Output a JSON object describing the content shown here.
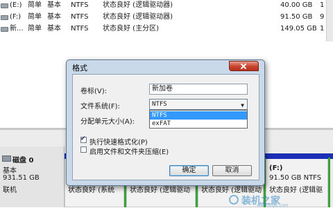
{
  "volumes": [
    {
      "volume": "(E:)",
      "layout": "简单",
      "type": "基本",
      "fs": "NTFS",
      "status": "状态良好 (逻辑驱动器)",
      "capacity": "40.00 GB",
      "free": "1"
    },
    {
      "volume": "(F:)",
      "layout": "简单",
      "type": "基本",
      "fs": "NTFS",
      "status": "状态良好 (逻辑驱动器)",
      "capacity": "91.50 GB",
      "free": "9"
    },
    {
      "volume": "新...",
      "layout": "简单",
      "type": "基本",
      "fs": "NTFS",
      "status": "状态良好 (主分区)",
      "capacity": "149.05 GB",
      "free": "1"
    }
  ],
  "disk": {
    "name": "磁盘 0",
    "type": "基本",
    "size": "931.51 GB",
    "state": "联机"
  },
  "partitions": [
    {
      "l1": "",
      "l2": "",
      "l3": "状态良好 (系统"
    },
    {
      "l1": "",
      "l2": "",
      "l3": "状态良好 (逻辑驱动"
    },
    {
      "l1": "",
      "l2": "",
      "l3": "状态良好 (逻辑驱动"
    },
    {
      "l1": "(F:)",
      "l2": "91.50 GB NTFS",
      "l3": "状态良好 (逻辑驱"
    }
  ],
  "dialog": {
    "title": "格式",
    "label_volume": "卷标(V):",
    "volume_value": "新加卷",
    "label_fs": "文件系统(F):",
    "fs_value": "NTFS",
    "fs_options": [
      "NTFS",
      "exFAT"
    ],
    "label_alloc": "分配单元大小(A):",
    "quick_format": "执行快速格式化(P)",
    "quick_format_checked": true,
    "compress": "启用文件和文件夹压缩(E)",
    "compress_checked": false,
    "ok": "确定",
    "cancel": "取消"
  },
  "watermark": {
    "text": "装机之家",
    "url": "www.lotpc.com"
  },
  "colors": {
    "partition_bar": "#1b2fb7",
    "selection": "#3399ff",
    "close_red": "#c6442e",
    "dialog_frame": "#c9d9ea"
  }
}
